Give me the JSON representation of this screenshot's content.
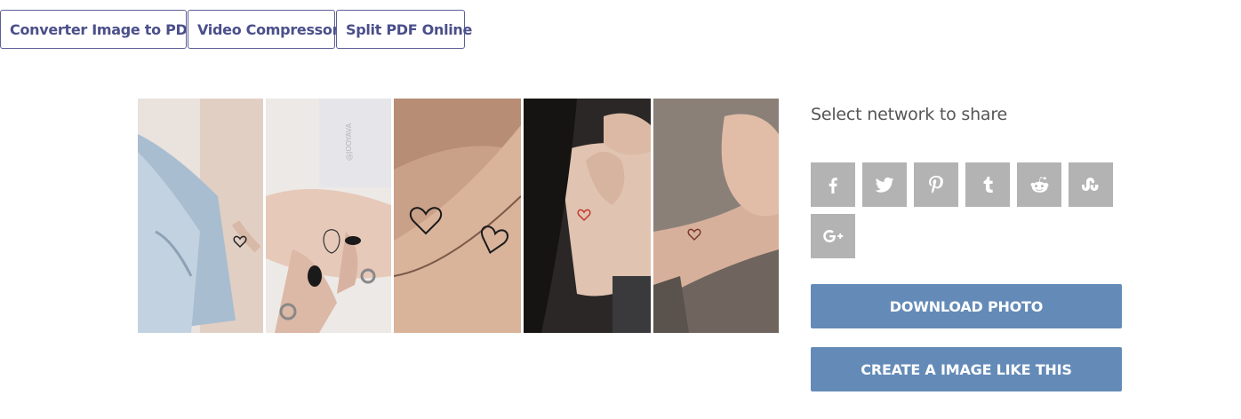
{
  "tool_links": [
    {
      "label": "Converter Image to PDF"
    },
    {
      "label": "Video Compressor"
    },
    {
      "label": "Split PDF Online"
    }
  ],
  "share": {
    "title": "Select network to share",
    "networks": [
      "facebook",
      "twitter",
      "pinterest",
      "tumblr",
      "reddit",
      "stumbleupon",
      "google-plus"
    ]
  },
  "actions": {
    "download": "DOWNLOAD PHOTO",
    "create": "CREATE A IMAGE LIKE THIS"
  },
  "collage": {
    "watermark": "@JOOYAVA"
  },
  "colors": {
    "tool_border": "#5b5f97",
    "share_icon_bg": "#b3b3b3",
    "action_bg": "#648bb8"
  }
}
